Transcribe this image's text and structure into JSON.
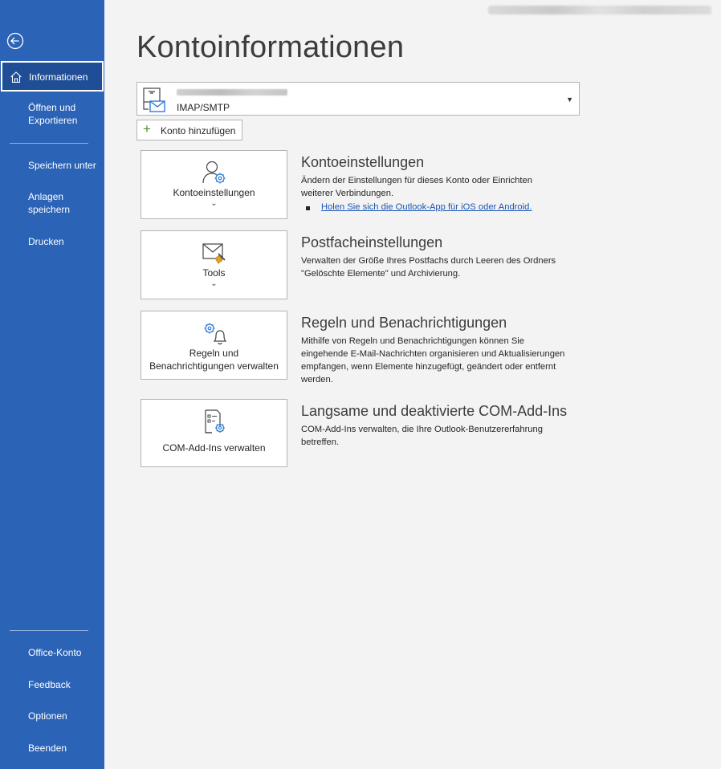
{
  "sidebar": {
    "items": [
      {
        "label": "Informationen"
      },
      {
        "label": "Öffnen und\nExportieren"
      },
      {
        "label": "Speichern unter"
      },
      {
        "label": "Anlagen\nspeichern"
      },
      {
        "label": "Drucken"
      },
      {
        "label": "Office-Konto"
      },
      {
        "label": "Feedback"
      },
      {
        "label": "Optionen"
      },
      {
        "label": "Beenden"
      }
    ]
  },
  "page": {
    "title": "Kontoinformationen"
  },
  "account": {
    "type": "IMAP/SMTP",
    "add_label": "Konto hinzufügen"
  },
  "sections": [
    {
      "button_label": "Kontoeinstellungen",
      "heading": "Kontoeinstellungen",
      "description": "Ändern der Einstellungen für dieses Konto oder Einrichten weiterer Verbindungen.",
      "link": "Holen Sie sich die Outlook-App für iOS oder Android."
    },
    {
      "button_label": "Tools",
      "heading": "Postfacheinstellungen",
      "description": "Verwalten der Größe Ihres Postfachs durch Leeren des Ordners \"Gelöschte Elemente\" und Archivierung."
    },
    {
      "button_label": "Regeln und\nBenachrichtigungen verwalten",
      "heading": "Regeln und Benachrichtigungen",
      "description": "Mithilfe von Regeln und Benachrichtigungen können Sie eingehende E-Mail-Nachrichten organisieren und Aktualisierungen empfangen, wenn Elemente hinzugefügt, geändert oder entfernt werden."
    },
    {
      "button_label": "COM-Add-Ins verwalten",
      "heading": "Langsame und deaktivierte COM-Add-Ins",
      "description": "COM-Add-Ins verwalten, die Ihre Outlook-Benutzererfahrung betreffen."
    }
  ],
  "colors": {
    "sidebar": "#2b63b7",
    "active": "#1f4e97",
    "link": "#1a55b5"
  }
}
